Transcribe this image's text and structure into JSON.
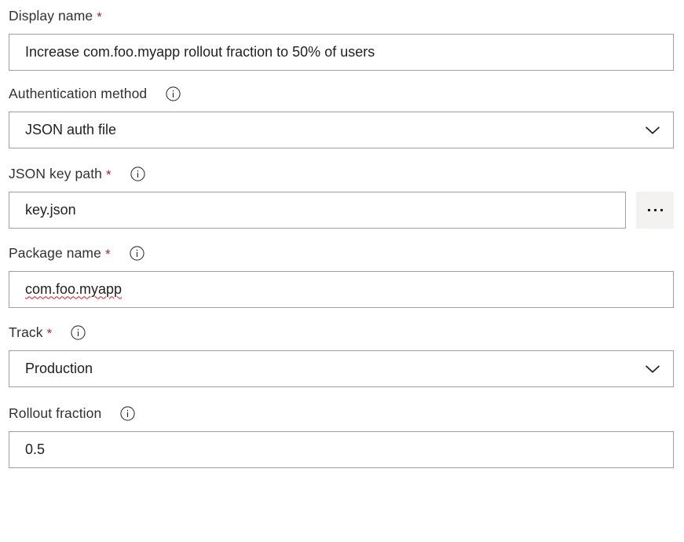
{
  "form": {
    "fields": [
      {
        "id": "display-name",
        "label": "Display name",
        "required": true,
        "has_info": false,
        "control": "textbox",
        "value": "Increase com.foo.myapp rollout fraction to 50% of users",
        "placeholder": "",
        "spellcheck_error": false
      },
      {
        "id": "authentication-method",
        "label": "Authentication method",
        "required": false,
        "has_info": true,
        "control": "dropdown",
        "value": "JSON auth file",
        "options": [
          "JSON auth file"
        ]
      },
      {
        "id": "json-key-path",
        "label": "JSON key path",
        "required": true,
        "has_info": true,
        "control": "textbox-with-browse",
        "value": "key.json",
        "placeholder": "",
        "browse_label": "...",
        "spellcheck_error": false
      },
      {
        "id": "package-name",
        "label": "Package name",
        "required": true,
        "has_info": true,
        "control": "textbox",
        "value": "com.foo.myapp",
        "placeholder": "",
        "spellcheck_error": true
      },
      {
        "id": "track",
        "label": "Track",
        "required": true,
        "has_info": true,
        "control": "dropdown",
        "value": "Production",
        "options": [
          "Production"
        ]
      },
      {
        "id": "rollout-fraction",
        "label": "Rollout fraction",
        "required": false,
        "has_info": true,
        "control": "textbox",
        "value": "0.5",
        "placeholder": "",
        "spellcheck_error": false
      }
    ]
  },
  "icons": {
    "info": "info-circle-icon",
    "chevron": "chevron-down-icon",
    "ellipsis": "ellipsis-icon"
  },
  "colors": {
    "required_asterisk": "#a4262c",
    "border": "#a19f9d",
    "text": "#201f1e",
    "label": "#323130",
    "button_bg": "#f3f2f1",
    "spellcheck": "#e81123"
  }
}
